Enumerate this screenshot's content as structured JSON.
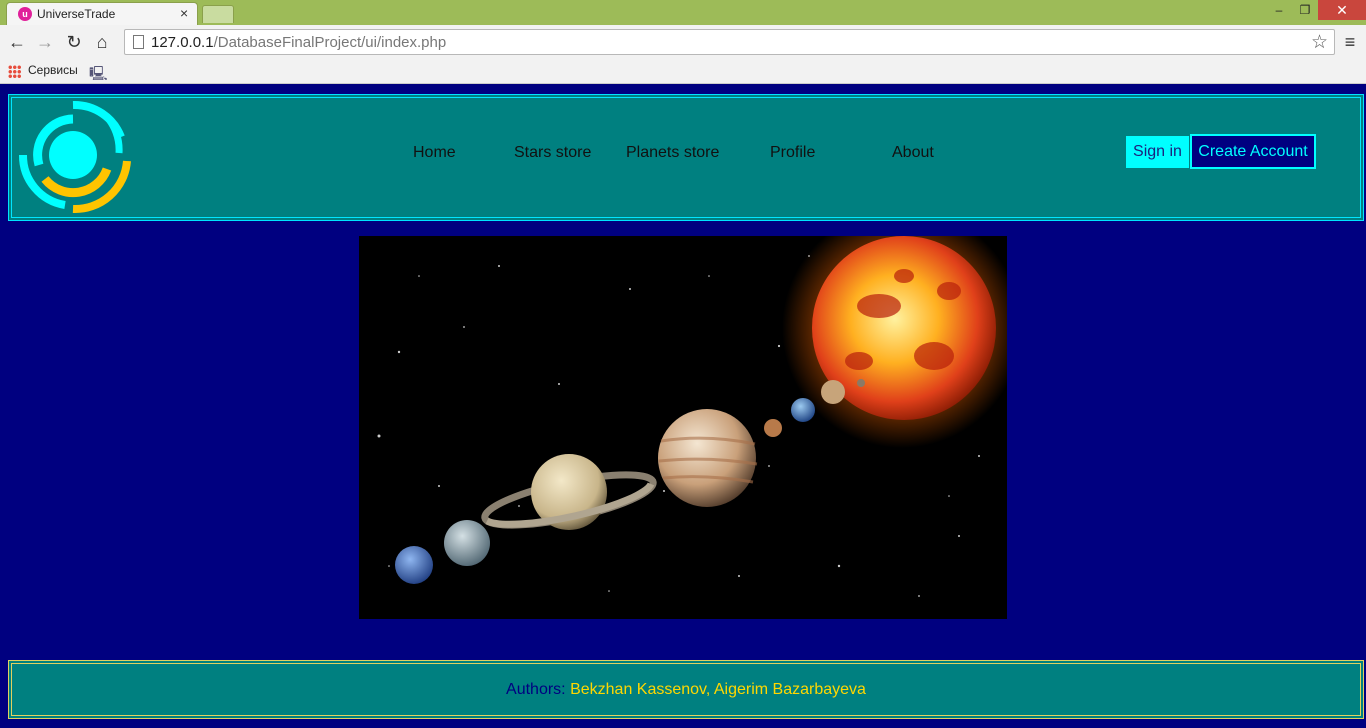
{
  "browser": {
    "tab_title": "UniverseTrade",
    "tab_close": "×",
    "url_host": "127.0.0.1",
    "url_path": "/DatabaseFinalProject/ui/index.php",
    "bookmarks_label": "Сервисы",
    "window_minimize": "‒",
    "window_restore": "❐",
    "window_close": "✕",
    "back": "←",
    "forward": "→",
    "reload": "↻",
    "home": "⌂",
    "star": "☆",
    "menu": "≡"
  },
  "nav": {
    "items": [
      {
        "label": "Home"
      },
      {
        "label": "Stars store"
      },
      {
        "label": "Planets store"
      },
      {
        "label": "Profile"
      },
      {
        "label": "About"
      }
    ],
    "sign_in": "Sign in",
    "create_account": "Create Account"
  },
  "footer": {
    "authors_label": "Authors:",
    "authors_names": "Bekzhan Kassenov, Aigerim Bazarbayeva"
  },
  "colors": {
    "page_bg": "#000080",
    "panel_bg": "#008080",
    "accent_cyan": "#00ffff",
    "accent_gold": "#ffd700"
  }
}
